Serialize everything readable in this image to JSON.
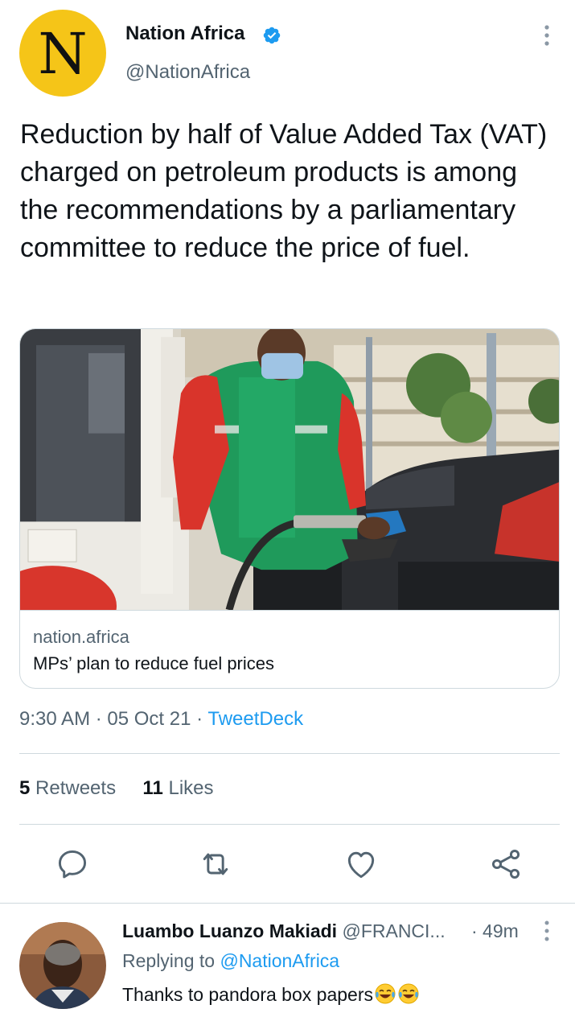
{
  "tweet": {
    "author": {
      "display_name": "Nation Africa",
      "handle": "@NationAfrica",
      "avatar_letter": "N",
      "avatar_color": "#f5c518",
      "verified": true
    },
    "text": "Reduction by half of Value Added Tax (VAT) charged on petroleum products is among the recommendations by a parliamentary committee to reduce the price of fuel.",
    "card": {
      "domain": "nation.africa",
      "title": "MPs’ plan to reduce fuel prices"
    },
    "time": "9:30 AM",
    "date": "05 Oct 21",
    "separator": " · ",
    "source": "TweetDeck",
    "stats": {
      "retweets_count": "5",
      "retweets_label": "Retweets",
      "likes_count": "11",
      "likes_label": "Likes"
    },
    "actions": [
      "reply-icon",
      "retweet-icon",
      "like-icon",
      "share-icon"
    ]
  },
  "reply": {
    "display_name": "Luambo Luanzo Makiadi",
    "handle": "@FRANCI...",
    "time": "· 49m",
    "replying_prefix": "Replying to",
    "replying_to": "@NationAfrica",
    "text": "Thanks to pandora box papers",
    "emoji": [
      "face-with-tears-of-joy-icon",
      "face-with-tears-of-joy-icon"
    ]
  },
  "colors": {
    "accent": "#1d9bf0",
    "text_primary": "#0f1419",
    "text_secondary": "#536471",
    "border": "#cfd9de"
  }
}
